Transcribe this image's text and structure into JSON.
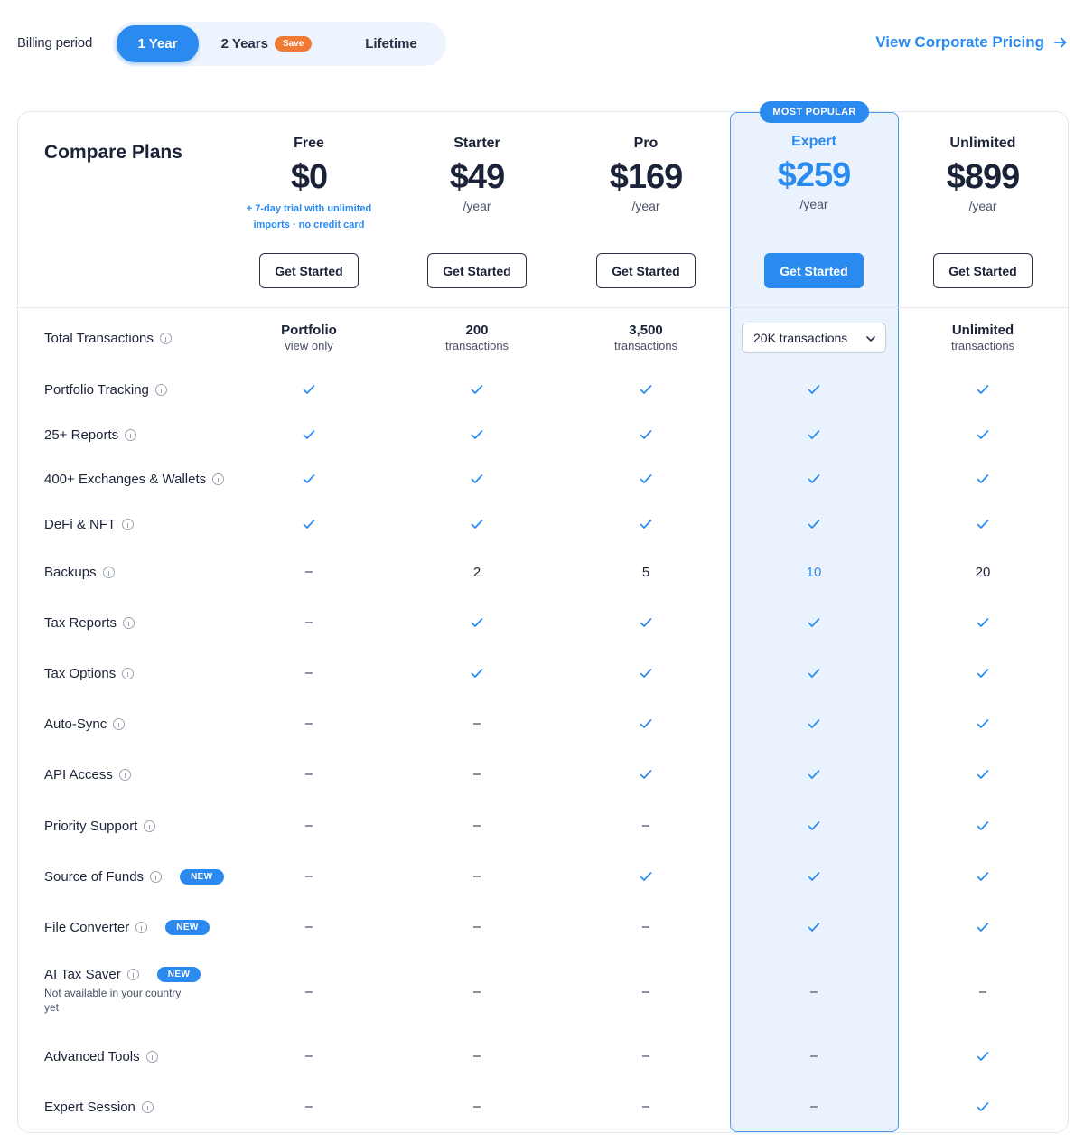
{
  "billing": {
    "label": "Billing period",
    "options": [
      "1 Year",
      "2 Years",
      "Lifetime"
    ],
    "selected": "1 Year",
    "save_badge": "Save"
  },
  "corporate_link": "View Corporate Pricing",
  "compare_title": "Compare Plans",
  "popular_badge": "MOST POPULAR",
  "plans": [
    {
      "name": "Free",
      "price": "$0",
      "per": "",
      "note": "+ 7-day trial with unlimited imports · no credit card",
      "button": "Get Started"
    },
    {
      "name": "Starter",
      "price": "$49",
      "per": "/year",
      "note": "",
      "button": "Get Started"
    },
    {
      "name": "Pro",
      "price": "$169",
      "per": "/year",
      "note": "",
      "button": "Get Started"
    },
    {
      "name": "Expert",
      "price": "$259",
      "per": "/year",
      "note": "",
      "button": "Get Started"
    },
    {
      "name": "Unlimited",
      "price": "$899",
      "per": "/year",
      "note": "",
      "button": "Get Started"
    }
  ],
  "transactions": {
    "label": "Total Transactions",
    "free_main": "Portfolio",
    "free_sub": "view only",
    "starter_main": "200",
    "starter_sub": "transactions",
    "pro_main": "3,500",
    "pro_sub": "transactions",
    "expert_select": "20K transactions",
    "unlimited_main": "Unlimited",
    "unlimited_sub": "transactions"
  },
  "features": [
    {
      "label": "Portfolio Tracking",
      "values": [
        "check",
        "check",
        "check",
        "check",
        "check"
      ]
    },
    {
      "label": "25+ Reports",
      "values": [
        "check",
        "check",
        "check",
        "check",
        "check"
      ]
    },
    {
      "label": "400+ Exchanges & Wallets",
      "values": [
        "check",
        "check",
        "check",
        "check",
        "check"
      ]
    },
    {
      "label": "DeFi & NFT",
      "values": [
        "check",
        "check",
        "check",
        "check",
        "check"
      ]
    },
    {
      "label": "Backups",
      "values": [
        "dash",
        "2",
        "5",
        "10",
        "20"
      ]
    },
    {
      "label": "Tax Reports",
      "values": [
        "dash",
        "check",
        "check",
        "check",
        "check"
      ]
    },
    {
      "label": "Tax Options",
      "values": [
        "dash",
        "check",
        "check",
        "check",
        "check"
      ]
    },
    {
      "label": "Auto-Sync",
      "values": [
        "dash",
        "dash",
        "check",
        "check",
        "check"
      ]
    },
    {
      "label": "API Access",
      "values": [
        "dash",
        "dash",
        "check",
        "check",
        "check"
      ]
    },
    {
      "label": "Priority Support",
      "values": [
        "dash",
        "dash",
        "dash",
        "check",
        "check"
      ]
    },
    {
      "label": "Source of Funds",
      "badge": "NEW",
      "values": [
        "dash",
        "dash",
        "check",
        "check",
        "check"
      ]
    },
    {
      "label": "File Converter",
      "badge": "NEW",
      "values": [
        "dash",
        "dash",
        "dash",
        "check",
        "check"
      ]
    },
    {
      "label": "AI Tax Saver",
      "badge": "NEW",
      "sub": "Not available in your country yet",
      "values": [
        "dash",
        "dash",
        "dash",
        "dash",
        "dash"
      ]
    },
    {
      "label": "Advanced Tools",
      "values": [
        "dash",
        "dash",
        "dash",
        "dash",
        "check"
      ]
    },
    {
      "label": "Expert Session",
      "values": [
        "dash",
        "dash",
        "dash",
        "dash",
        "check"
      ]
    }
  ],
  "colors": {
    "accent": "#2b8aef",
    "save": "#f07a34",
    "highlight_bg": "#eaf3fd"
  }
}
